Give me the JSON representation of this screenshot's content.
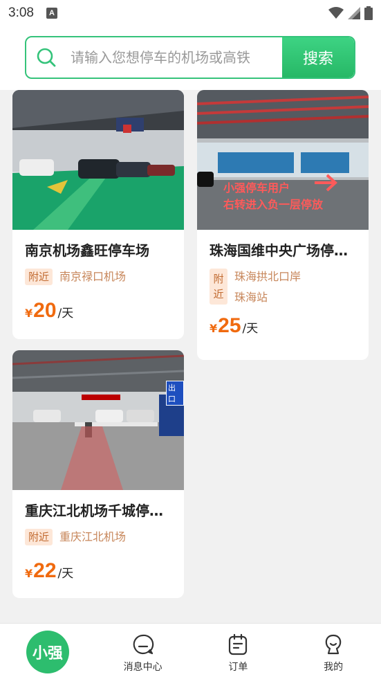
{
  "status_bar": {
    "time": "3:08",
    "notification_icon_label": "A",
    "icons": [
      "wifi-icon",
      "signal-icon",
      "battery-icon"
    ]
  },
  "search": {
    "placeholder": "请输入您想停车的机场或高铁",
    "button_label": "搜索"
  },
  "colors": {
    "brand_green": "#2dbd6e",
    "price_orange": "#f06a0f",
    "near_badge_bg": "#fde7d8",
    "near_text": "#c7865a"
  },
  "listings": [
    {
      "title": "南京机场鑫旺停车场",
      "near_label": "附近",
      "near_places": [
        "南京禄口机场"
      ],
      "price_symbol": "¥",
      "price": "20",
      "price_unit": "/天"
    },
    {
      "title": "珠海国维中央广场停车…",
      "photo_caption_line1": "小强停车用户",
      "photo_caption_line2": "右转进入负一层停放",
      "near_label": "附近",
      "near_places": [
        "珠海拱北口岸",
        "珠海站"
      ],
      "price_symbol": "¥",
      "price": "25",
      "price_unit": "/天"
    },
    {
      "title": "重庆江北机场千城停车…",
      "photo_sign_exit": "出口",
      "near_label": "附近",
      "near_places": [
        "重庆江北机场"
      ],
      "price_symbol": "¥",
      "price": "22",
      "price_unit": "/天"
    }
  ],
  "tabbar": {
    "home_label": "小强",
    "items": [
      {
        "label": "消息中心",
        "icon": "message-icon"
      },
      {
        "label": "订单",
        "icon": "order-icon"
      },
      {
        "label": "我的",
        "icon": "profile-icon"
      }
    ]
  }
}
